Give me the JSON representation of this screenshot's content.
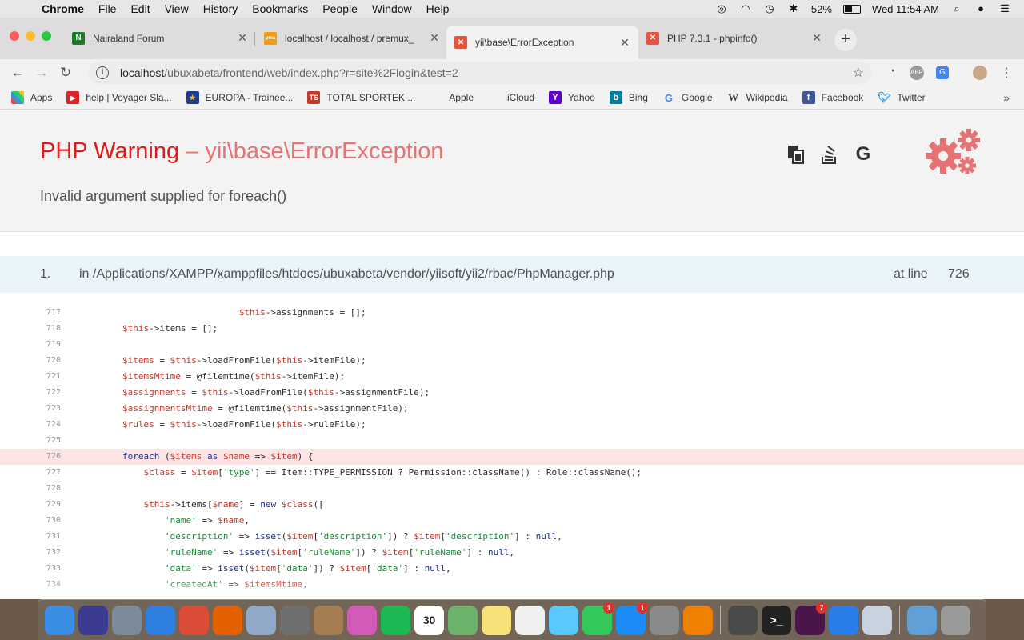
{
  "menubar": {
    "app": "Chrome",
    "items": [
      "File",
      "Edit",
      "View",
      "History",
      "Bookmarks",
      "People",
      "Window",
      "Help"
    ],
    "battery": "52%",
    "clock": "Wed 11:54 AM"
  },
  "tabs": [
    {
      "title": "Nairaland Forum",
      "favicon_color": "#1f7a2e",
      "favicon_text": "N"
    },
    {
      "title": "localhost / localhost / premux_",
      "favicon_color": "#f39c12",
      "favicon_text": "pma"
    },
    {
      "title": "yii\\base\\ErrorException",
      "favicon_color": "#e8553e",
      "favicon_text": "X"
    },
    {
      "title": "PHP 7.3.1 - phpinfo()",
      "favicon_color": "#e8553e",
      "favicon_text": "X"
    }
  ],
  "omnibox": {
    "host": "localhost",
    "path": "/ubuxabeta/frontend/web/index.php?r=site%2Flogin&test=2"
  },
  "bookmarks": [
    {
      "label": "Apps",
      "icon": "apps-grid-icon",
      "color": "#e74c3c"
    },
    {
      "label": "help | Voyager Sla...",
      "icon": "youtube-icon",
      "color": "#e02424"
    },
    {
      "label": "EUROPA - Trainee...",
      "icon": "eu-flag-icon",
      "color": "#1f3a93"
    },
    {
      "label": "TOTAL SPORTEK ...",
      "icon": "ts-icon",
      "color": "#c0392b"
    },
    {
      "label": "Apple",
      "icon": "apple-icon",
      "color": "#888888"
    },
    {
      "label": "iCloud",
      "icon": "apple-icon",
      "color": "#888888"
    },
    {
      "label": "Yahoo",
      "icon": "yahoo-icon",
      "color": "#5f01d1"
    },
    {
      "label": "Bing",
      "icon": "bing-icon",
      "color": "#00809d"
    },
    {
      "label": "Google",
      "icon": "google-icon",
      "color": "#4285f4"
    },
    {
      "label": "Wikipedia",
      "icon": "wikipedia-icon",
      "color": "#333333"
    },
    {
      "label": "Facebook",
      "icon": "facebook-icon",
      "color": "#3b5998"
    },
    {
      "label": "Twitter",
      "icon": "twitter-icon",
      "color": "#1da1f2"
    }
  ],
  "error": {
    "type": "PHP Warning",
    "separator": "–",
    "class": "yii\\base\\ErrorException",
    "message": "Invalid argument supplied for foreach()"
  },
  "callstack": {
    "number": "1.",
    "file": "in /Applications/XAMPP/xamppfiles/htdocs/ubuxabeta/vendor/yiisoft/yii2/rbac/PhpManager.php",
    "at_label": "at line",
    "line": "726"
  },
  "code": {
    "highlight_line": "726",
    "lines": [
      {
        "n": "717",
        "html": "                              <span class=\"var\">$this</span>->assignments = [];"
      },
      {
        "n": "718",
        "html": "        <span class=\"var\">$this</span>->items = [];"
      },
      {
        "n": "719",
        "html": ""
      },
      {
        "n": "720",
        "html": "        <span class=\"var\">$items</span> = <span class=\"var\">$this</span>->loadFromFile(<span class=\"var\">$this</span>->itemFile);"
      },
      {
        "n": "721",
        "html": "        <span class=\"var\">$itemsMtime</span> = @filemtime(<span class=\"var\">$this</span>->itemFile);"
      },
      {
        "n": "722",
        "html": "        <span class=\"var\">$assignments</span> = <span class=\"var\">$this</span>->loadFromFile(<span class=\"var\">$this</span>->assignmentFile);"
      },
      {
        "n": "723",
        "html": "        <span class=\"var\">$assignmentsMtime</span> = @filemtime(<span class=\"var\">$this</span>->assignmentFile);"
      },
      {
        "n": "724",
        "html": "        <span class=\"var\">$rules</span> = <span class=\"var\">$this</span>->loadFromFile(<span class=\"var\">$this</span>->ruleFile);"
      },
      {
        "n": "725",
        "html": ""
      },
      {
        "n": "726",
        "html": "        <span class=\"kw\">foreach</span> (<span class=\"var\">$items</span> <span class=\"kw\">as</span> <span class=\"var\">$name</span> => <span class=\"var\">$item</span>) {"
      },
      {
        "n": "727",
        "html": "            <span class=\"var\">$class</span> = <span class=\"var\">$item</span>[<span class=\"str\">'type'</span>] == Item::TYPE_PERMISSION ? Permission::className() : Role::className();"
      },
      {
        "n": "728",
        "html": ""
      },
      {
        "n": "729",
        "html": "            <span class=\"var\">$this</span>->items[<span class=\"var\">$name</span>] = <span class=\"kw\">new</span> <span class=\"var\">$class</span>(["
      },
      {
        "n": "730",
        "html": "                <span class=\"str\">'name'</span> => <span class=\"var\">$name</span>,"
      },
      {
        "n": "731",
        "html": "                <span class=\"str\">'description'</span> => <span class=\"kw\">isset</span>(<span class=\"var\">$item</span>[<span class=\"str\">'description'</span>]) ? <span class=\"var\">$item</span>[<span class=\"str\">'description'</span>] : <span class=\"kw\">null</span>,"
      },
      {
        "n": "732",
        "html": "                <span class=\"str\">'ruleName'</span> => <span class=\"kw\">isset</span>(<span class=\"var\">$item</span>[<span class=\"str\">'ruleName'</span>]) ? <span class=\"var\">$item</span>[<span class=\"str\">'ruleName'</span>] : <span class=\"kw\">null</span>,"
      },
      {
        "n": "733",
        "html": "                <span class=\"str\">'data'</span> => <span class=\"kw\">isset</span>(<span class=\"var\">$item</span>[<span class=\"str\">'data'</span>]) ? <span class=\"var\">$item</span>[<span class=\"str\">'data'</span>] : <span class=\"kw\">null</span>,"
      },
      {
        "n": "734",
        "html": "                <span class=\"str\">'createdAt'</span> => <span class=\"var\">$itemsMtime</span>,"
      }
    ]
  },
  "dock": [
    {
      "name": "finder",
      "color": "#3a8ee6",
      "label": "",
      "badge": ""
    },
    {
      "name": "siri",
      "color": "#3b3b8f",
      "label": "",
      "badge": ""
    },
    {
      "name": "launchpad",
      "color": "#7d8a99",
      "label": "",
      "badge": ""
    },
    {
      "name": "safari",
      "color": "#2f7fe0",
      "label": "",
      "badge": ""
    },
    {
      "name": "chrome",
      "color": "#dd4b39",
      "label": "",
      "badge": ""
    },
    {
      "name": "firefox",
      "color": "#e66000",
      "label": "",
      "badge": ""
    },
    {
      "name": "preview",
      "color": "#8fa9c6",
      "label": "",
      "badge": ""
    },
    {
      "name": "calculator",
      "color": "#6f6f6f",
      "label": "",
      "badge": ""
    },
    {
      "name": "contacts",
      "color": "#a67c52",
      "label": "",
      "badge": ""
    },
    {
      "name": "itunes",
      "color": "#d45ab8",
      "label": "",
      "badge": ""
    },
    {
      "name": "spotify",
      "color": "#1db954",
      "label": "",
      "badge": ""
    },
    {
      "name": "calendar",
      "color": "#ffffff",
      "label": "30",
      "badge": ""
    },
    {
      "name": "maps",
      "color": "#6bb36b",
      "label": "",
      "badge": ""
    },
    {
      "name": "notes",
      "color": "#f7e27a",
      "label": "",
      "badge": ""
    },
    {
      "name": "photos",
      "color": "#f0f0f0",
      "label": "",
      "badge": ""
    },
    {
      "name": "messages",
      "color": "#5ac8fa",
      "label": "",
      "badge": ""
    },
    {
      "name": "facetime",
      "color": "#34c759",
      "label": "",
      "badge": "1"
    },
    {
      "name": "app-store",
      "color": "#1d8cf8",
      "label": "",
      "badge": "1"
    },
    {
      "name": "system-preferences",
      "color": "#8a8a8a",
      "label": "",
      "badge": ""
    },
    {
      "name": "vlc",
      "color": "#f08000",
      "label": "",
      "badge": ""
    },
    {
      "name": "sublime-text",
      "color": "#4a4a4a",
      "label": "",
      "badge": ""
    },
    {
      "name": "terminal",
      "color": "#222222",
      "label": ">_",
      "badge": ""
    },
    {
      "name": "slack",
      "color": "#4a154b",
      "label": "",
      "badge": "7"
    },
    {
      "name": "maps-pin",
      "color": "#2b7de9",
      "label": "",
      "badge": ""
    },
    {
      "name": "settings-utility",
      "color": "#c9d3df",
      "label": "",
      "badge": ""
    },
    {
      "name": "downloads",
      "color": "#5fa0d6",
      "label": "",
      "badge": ""
    },
    {
      "name": "trash",
      "color": "#9a9a9a",
      "label": "",
      "badge": ""
    }
  ]
}
